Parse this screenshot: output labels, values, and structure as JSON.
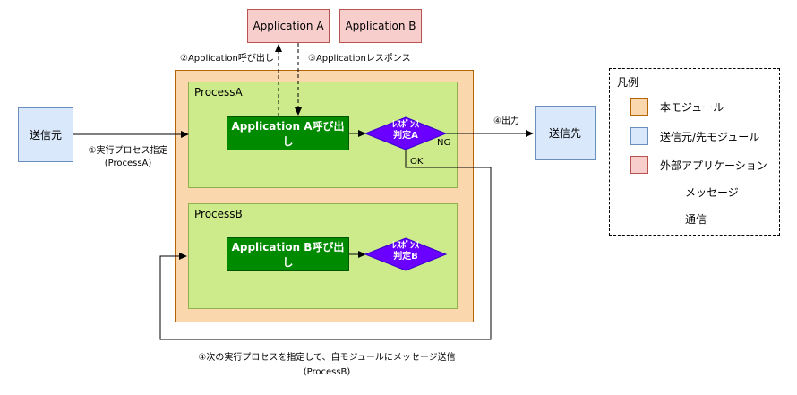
{
  "external": {
    "app_a": "Application A",
    "app_b": "Application B"
  },
  "nodes": {
    "sender": "送信元",
    "receiver": "送信先"
  },
  "module": {
    "process_a": {
      "title": "ProcessA",
      "call": "Application A呼び出し",
      "judge_line1": "ﾚｽﾎﾟﾝｽ",
      "judge_line2": "判定A"
    },
    "process_b": {
      "title": "ProcessB",
      "call": "Application B呼び出し",
      "judge_line1": "ﾚｽﾎﾟﾝｽ",
      "judge_line2": "判定B"
    }
  },
  "labels": {
    "step2": "②Application呼び出し",
    "step3": "③Applicationレスポンス",
    "step1_line1": "①実行プロセス指定",
    "step1_line2": "(ProcessA)",
    "step4_out": "④出力",
    "ng": "NG",
    "ok": "OK",
    "step4_next_line1": "④次の実行プロセスを指定して、自モジュールにメッセージ送信",
    "step4_next_line2": "(ProcessB)"
  },
  "legend": {
    "title": "凡例",
    "items": [
      {
        "label": "本モジュール",
        "color": "#fad7ac",
        "border": "#b46504"
      },
      {
        "label": "送信元/先モジュール",
        "color": "#dae8fc",
        "border": "#6c8ebf"
      },
      {
        "label": "外部アプリケーション",
        "color": "#f8cecc",
        "border": "#b85450"
      }
    ],
    "message": "メッセージ",
    "comm": "通信"
  },
  "colors": {
    "module": "#fad7ac",
    "process": "#cdeb8b",
    "call": "#008a00",
    "judge": "#6a00ff",
    "external": "#f8cecc",
    "node": "#dae8fc"
  }
}
